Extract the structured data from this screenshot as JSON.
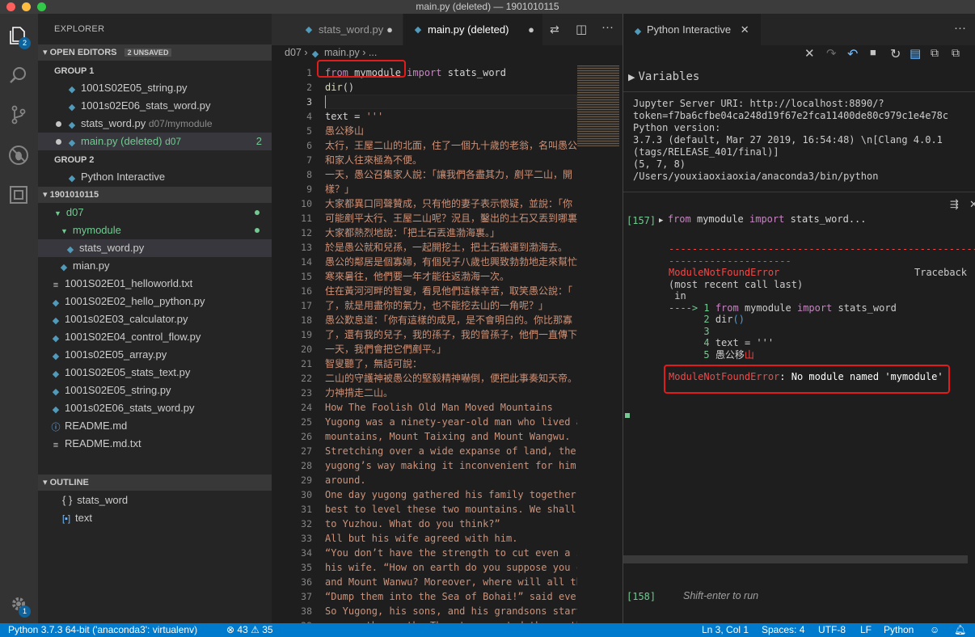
{
  "window": {
    "title": "main.py (deleted) — 1901010115"
  },
  "activity": {
    "explorer_badge": "2",
    "settings_badge": "1"
  },
  "sidebar": {
    "title": "EXPLORER",
    "open_editors": {
      "label": "OPEN EDITORS",
      "badge": "2 UNSAVED"
    },
    "group1": {
      "label": "GROUP 1",
      "items": [
        {
          "name": "1001S02E05_string.py",
          "extra": ""
        },
        {
          "name": "1001s02E06_stats_word.py",
          "extra": ""
        },
        {
          "name": "stats_word.py",
          "extra": "d07/mymodule"
        },
        {
          "name": "main.py (deleted)",
          "extra": "d07",
          "count": "2"
        }
      ]
    },
    "group2": {
      "label": "GROUP 2",
      "items": [
        {
          "name": "Python Interactive"
        }
      ]
    },
    "workspace": {
      "label": "1901010115"
    },
    "tree": {
      "d07": "d07",
      "mymodule": "mymodule",
      "stats_word": "stats_word.py",
      "mian": "mian.py",
      "files": [
        {
          "name": "1001S02E01_helloworld.txt",
          "icon": "text-file-icon"
        },
        {
          "name": "1001S02E02_hello_python.py",
          "icon": "python-file-icon"
        },
        {
          "name": "1001s02E03_calculator.py",
          "icon": "python-file-icon"
        },
        {
          "name": "1001S02E04_control_flow.py",
          "icon": "python-file-icon"
        },
        {
          "name": "1001s02E05_array.py",
          "icon": "python-file-icon"
        },
        {
          "name": "1001S02E05_stats_text.py",
          "icon": "python-file-icon"
        },
        {
          "name": "1001S02E05_string.py",
          "icon": "python-file-icon"
        },
        {
          "name": "1001s02E06_stats_word.py",
          "icon": "python-file-icon"
        },
        {
          "name": "README.md",
          "icon": "info-icon"
        },
        {
          "name": "README.md.txt",
          "icon": "text-file-icon"
        }
      ]
    },
    "outline": {
      "label": "OUTLINE",
      "items": [
        "stats_word",
        "text"
      ]
    }
  },
  "editor": {
    "tabs": [
      {
        "label": "stats_word.py"
      },
      {
        "label": "main.py (deleted)"
      }
    ],
    "breadcrumb": {
      "folder": "d07",
      "sep": "›",
      "file": "main.py",
      "tail": "› ..."
    },
    "lines": [
      {
        "n": "1",
        "t": "from mymodule import stats_word"
      },
      {
        "n": "2",
        "t": "dir()"
      },
      {
        "n": "3",
        "t": ""
      },
      {
        "n": "4",
        "t": "text = '''"
      },
      {
        "n": "5",
        "t": "愚公移山"
      },
      {
        "n": "6",
        "t": "太行，王屋二山的北面，住了一個九十歲的老翁，名叫愚公"
      },
      {
        "n": "7",
        "t": "和家人往來極為不便。"
      },
      {
        "n": "8",
        "t": "一天，愚公召集家人說：「讓我們各盡其力，剷平二山，開"
      },
      {
        "n": "9",
        "t": "樣？」"
      },
      {
        "n": "10",
        "t": "大家都異口同聲贊成，只有他的妻子表示懷疑，並說：「你"
      },
      {
        "n": "11",
        "t": "可能剷平太行、王屋二山呢？況且，鑿出的土石又丟到哪裏"
      },
      {
        "n": "12",
        "t": "大家都熱烈地說：「把土石丟進渤海裏。」"
      },
      {
        "n": "13",
        "t": "於是愚公就和兒孫，一起開挖土，把土石搬運到渤海去。"
      },
      {
        "n": "14",
        "t": "愚公的鄰居是個寡婦，有個兒子八歲也興致勃勃地走來幫忙"
      },
      {
        "n": "15",
        "t": "寒來暑往，他們要一年才能往返渤海一次。"
      },
      {
        "n": "16",
        "t": "住在黃河河畔的智叟，看見他們這樣辛苦，取笑愚公說：「"
      },
      {
        "n": "17",
        "t": "了，就是用盡你的氣力，也不能挖去山的一角呢？」"
      },
      {
        "n": "18",
        "t": "愚公歎息道：「你有這樣的成見，是不會明白的。你比那寡"
      },
      {
        "n": "19",
        "t": "了，還有我的兒子，我的孫子，我的曾孫子，他們一直傳下"
      },
      {
        "n": "20",
        "t": "一天，我們會把它們剷平。」"
      },
      {
        "n": "21",
        "t": "智叟聽了，無話可說："
      },
      {
        "n": "22",
        "t": "二山的守護神被愚公的堅毅精神嚇倒，便把此事奏知天帝。"
      },
      {
        "n": "23",
        "t": "力神揹走二山。"
      },
      {
        "n": "24",
        "t": "How The Foolish Old Man Moved Mountains"
      },
      {
        "n": "25",
        "t": "Yugong was a ninety-year-old man who lived a"
      },
      {
        "n": "26",
        "t": "mountains, Mount Taixing and Mount Wangwu."
      },
      {
        "n": "27",
        "t": "Stretching over a wide expanse of land, the"
      },
      {
        "n": "28",
        "t": "yugong’s way making it inconvenient for him"
      },
      {
        "n": "29",
        "t": "around."
      },
      {
        "n": "30",
        "t": "One day yugong gathered his family together"
      },
      {
        "n": "31",
        "t": "best to level these two mountains. We shall"
      },
      {
        "n": "32",
        "t": "to Yuzhou. What do you think?”"
      },
      {
        "n": "33",
        "t": "All but his wife agreed with him."
      },
      {
        "n": "34",
        "t": "“You don’t have the strength to cut even a s"
      },
      {
        "n": "35",
        "t": "his wife. “How on earth do you suppose you c"
      },
      {
        "n": "36",
        "t": "and Mount Wanwu? Moreover, where will all th"
      },
      {
        "n": "37",
        "t": "“Dump them into the Sea of Bohai!” said ever"
      },
      {
        "n": "38",
        "t": "So Yugong, his sons, and his grandsons start"
      },
      {
        "n": "39",
        "t": "remove the earth. They transported the earth"
      }
    ]
  },
  "interactive": {
    "tab_label": "Python Interactive",
    "variables_label": "Variables",
    "info": [
      "Jupyter Server URI: http://localhost:8890/?",
      "token=f7ba6cfbe04ca248d19f67e2fca11400de80c979c1e4e78c",
      "Python version:",
      "3.7.3 (default, Mar 27 2019, 16:54:48) \\n[Clang 4.0.1",
      "(tags/RELEASE_401/final)]",
      "(5, 7, 8)",
      "/Users/youxiaoxiaoxia/anaconda3/bin/python"
    ],
    "cell1": {
      "label": "[157]",
      "code": {
        "kw1": "from",
        "mod": " mymodule ",
        "kw2": "import",
        "rest": " stats_word..."
      },
      "dashes1": "------------------------------------------------------------",
      "dashes2": "---------------------",
      "error_name": "ModuleNotFoundError",
      "traceback": "Traceback",
      "tb2": "(most recent call last)",
      "tb3": " in",
      "arrow": "----> 1",
      "l1": {
        "kw1": "from",
        "mod": " mymodule ",
        "kw2": "import",
        "rest": " stats_word"
      },
      "l2n": "2",
      "l2": "dir",
      "l3n": "3",
      "l4n": "4",
      "l4": "text = '''",
      "l5n": "5",
      "l5a": "愚公移",
      "l5b": "山",
      "final_err": "ModuleNotFoundError",
      "final_msg": ": No module named 'mymodule'"
    },
    "cell2": {
      "label": "[158]",
      "placeholder": "Shift-enter to run"
    }
  },
  "statusbar": {
    "python": "Python 3.7.3 64-bit ('anaconda3': virtualenv)",
    "errors": "43",
    "warnings": "35",
    "position": "Ln 3, Col 1",
    "spaces": "Spaces: 4",
    "encoding": "UTF-8",
    "eol": "LF",
    "language": "Python"
  }
}
